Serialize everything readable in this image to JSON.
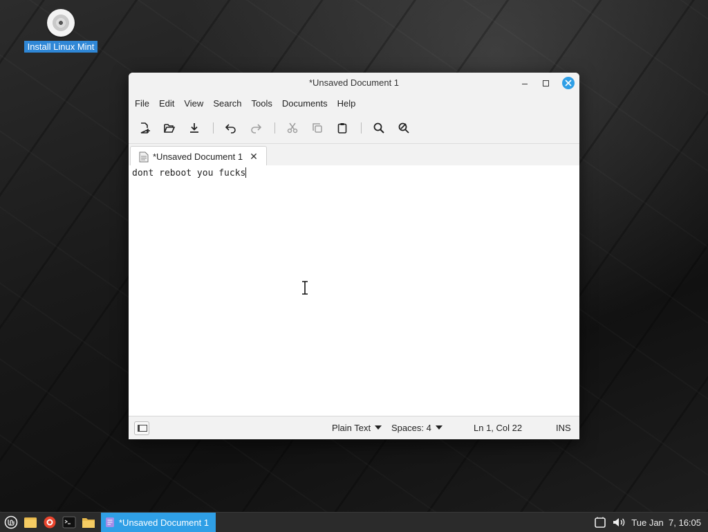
{
  "desktop": {
    "icon_label": "Install Linux Mint",
    "icon_name": "disc-icon"
  },
  "window": {
    "title": "*Unsaved Document 1",
    "menu": [
      "File",
      "Edit",
      "View",
      "Search",
      "Tools",
      "Documents",
      "Help"
    ],
    "toolbar_icons": [
      "new-document-icon",
      "open-folder-icon",
      "save-download-icon",
      "undo-icon",
      "redo-icon",
      "cut-icon",
      "copy-icon",
      "paste-icon",
      "search-icon",
      "replace-icon"
    ],
    "tab": {
      "label": "*Unsaved Document 1",
      "close": "✕"
    },
    "editor_text": "dont reboot you fucks",
    "status": {
      "language": "Plain Text",
      "indent": "Spaces: 4",
      "position": "Ln 1, Col 22",
      "mode": "INS"
    }
  },
  "taskbar": {
    "active_task": "*Unsaved Document 1",
    "clock": "Tue Jan  7, 16:05",
    "accent": "#2f9fe6"
  }
}
